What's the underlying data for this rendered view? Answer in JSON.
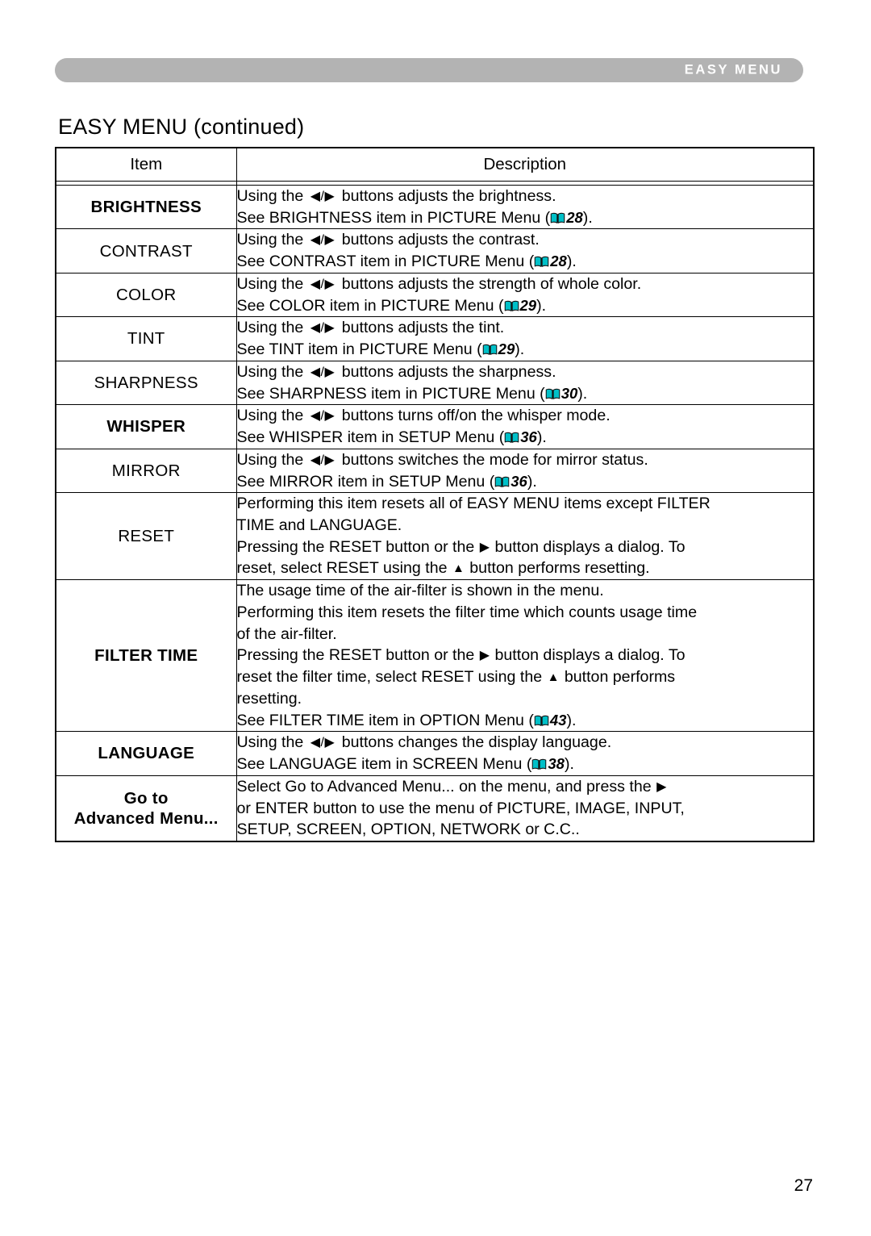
{
  "header": {
    "band_label": "EASY MENU"
  },
  "page_title": "EASY MENU (continued)",
  "table": {
    "columns": {
      "item": "Item",
      "description": "Description"
    },
    "rows": [
      {
        "item": "BRIGHTNESS",
        "bold": true,
        "lines": [
          {
            "pre": "Using the ",
            "arrows": "◀/▶",
            "post": " buttons adjusts the brightness."
          },
          {
            "pre": "See BRIGHTNESS item in PICTURE Menu (",
            "book": true,
            "ref": "28",
            "post": ")."
          }
        ]
      },
      {
        "item": "CONTRAST",
        "bold": false,
        "lines": [
          {
            "pre": "Using the ",
            "arrows": "◀/▶",
            "post": " buttons adjusts the contrast."
          },
          {
            "pre": "See CONTRAST item in PICTURE Menu (",
            "book": true,
            "ref": "28",
            "post": ")."
          }
        ]
      },
      {
        "item": "COLOR",
        "bold": false,
        "lines": [
          {
            "pre": "Using the ",
            "arrows": "◀/▶",
            "post": " buttons adjusts the strength of whole color."
          },
          {
            "pre": "See COLOR item in PICTURE Menu (",
            "book": true,
            "ref": "29",
            "post": ")."
          }
        ]
      },
      {
        "item": "TINT",
        "bold": false,
        "lines": [
          {
            "pre": "Using the ",
            "arrows": "◀/▶",
            "post": " buttons adjusts the tint."
          },
          {
            "pre": "See TINT item in PICTURE Menu (",
            "book": true,
            "ref": "29",
            "post": ")."
          }
        ]
      },
      {
        "item": "SHARPNESS",
        "bold": false,
        "lines": [
          {
            "pre": "Using the ",
            "arrows": "◀/▶",
            "post": " buttons adjusts the sharpness."
          },
          {
            "pre": "See SHARPNESS item in PICTURE Menu (",
            "book": true,
            "ref": "30",
            "post": ")."
          }
        ]
      },
      {
        "item": "WHISPER",
        "bold": true,
        "lines": [
          {
            "pre": "Using the ",
            "arrows": "◀/▶",
            "post": " buttons turns off/on the whisper mode."
          },
          {
            "pre": "See WHISPER item in SETUP Menu (",
            "book": true,
            "ref": "36",
            "post": ")."
          }
        ]
      },
      {
        "item": "MIRROR",
        "bold": false,
        "lines": [
          {
            "pre": "Using the ",
            "arrows": "◀/▶",
            "post": " buttons switches the mode for mirror status."
          },
          {
            "pre": "See MIRROR item in SETUP Menu (",
            "book": true,
            "ref": "36",
            "post": ")."
          }
        ]
      },
      {
        "item": "RESET",
        "bold": false,
        "lines": [
          {
            "pre": "Performing this item resets all of EASY MENU items except FILTER"
          },
          {
            "pre": "TIME and LANGUAGE."
          },
          {
            "pre": "Pressing the RESET button or the ",
            "arrow_r": "▶",
            "post": " button displays a dialog. To"
          },
          {
            "pre": "reset, select RESET using the ",
            "arrow_u": "▲",
            "post": " button performs resetting."
          }
        ]
      },
      {
        "item": "FILTER TIME",
        "bold": true,
        "lines": [
          {
            "pre": "The usage time of the air-filter is shown in the menu."
          },
          {
            "pre": "Performing this item resets the filter time which counts usage time"
          },
          {
            "pre": "of the air-filter."
          },
          {
            "pre": "Pressing the RESET button or the ",
            "arrow_r": "▶",
            "post": " button displays a dialog. To"
          },
          {
            "pre": "reset the filter time, select RESET using the ",
            "arrow_u": "▲",
            "post": " button performs"
          },
          {
            "pre": "resetting."
          },
          {
            "pre": "See FILTER TIME item in OPTION Menu (",
            "book": true,
            "ref": "43",
            "post": ")."
          }
        ]
      },
      {
        "item": "LANGUAGE",
        "bold": true,
        "lines": [
          {
            "pre": "Using the ",
            "arrows": "◀/▶",
            "post": " buttons changes the display language."
          },
          {
            "pre": "See LANGUAGE item in SCREEN Menu (",
            "book": true,
            "ref": "38",
            "post": ")."
          }
        ]
      },
      {
        "item": "Go to\nAdvanced Menu...",
        "bold": true,
        "lines": [
          {
            "pre": "Select Go to Advanced Menu... on the menu, and press the ",
            "arrow_r": "▶"
          },
          {
            "pre": "or ENTER button to use the menu of PICTURE, IMAGE, INPUT,"
          },
          {
            "pre": "SETUP, SCREEN, OPTION, NETWORK or C.C.."
          }
        ]
      }
    ]
  },
  "folio": "27",
  "colors": {
    "band": "#b3b3b3",
    "book_icon": "#00c0c8",
    "text": "#000000"
  }
}
